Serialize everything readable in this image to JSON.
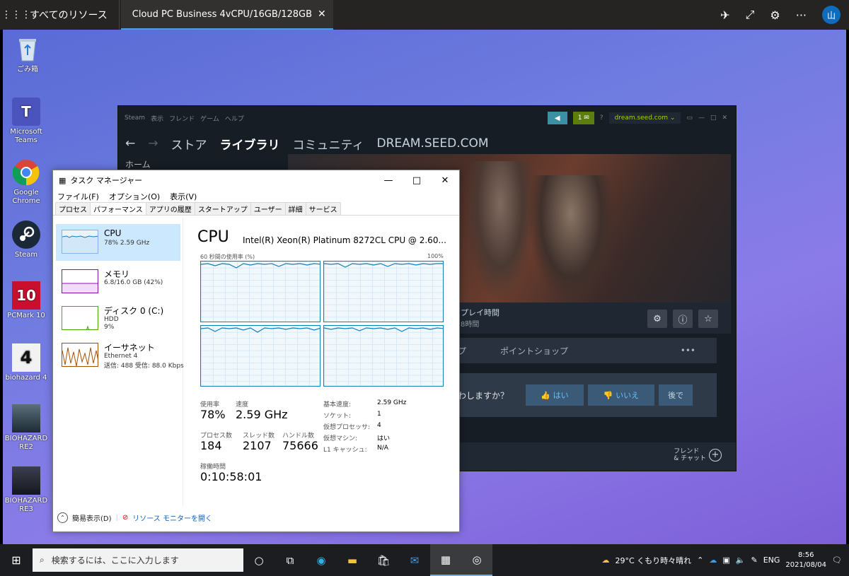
{
  "topbar": {
    "all_resources": "すべてのリソース",
    "tab_title": "Cloud PC Business 4vCPU/16GB/128GB",
    "avatar": "山"
  },
  "desktop_icons": [
    {
      "label": "ごみ箱"
    },
    {
      "label": "Microsoft Teams"
    },
    {
      "label": "Google Chrome"
    },
    {
      "label": "Steam"
    },
    {
      "label": "PCMark 10"
    },
    {
      "label": "biohazard 4"
    },
    {
      "label": "BIOHAZARD RE2"
    },
    {
      "label": "BIOHAZARD RE3"
    }
  ],
  "steam": {
    "menu": [
      "Steam",
      "表示",
      "フレンド",
      "ゲーム",
      "ヘルプ"
    ],
    "msg_count": "1",
    "account": "dream.seed.com ⌄",
    "nav": [
      "ストア",
      "ライブラリ",
      "コミュニティ",
      "DREAM.SEED.COM"
    ],
    "side_home": "ホーム",
    "playtime_label": "プレイ時間",
    "playtime_value": "8時間",
    "tab_left": "プ",
    "tab_points": "ポイントショップ",
    "tab_more": "•••",
    "prompt_text": "わしますか？",
    "btn_yes": "はい",
    "btn_no": "いいえ",
    "btn_later": "後で",
    "friends_line1": "フレンド",
    "friends_line2": "& チャット"
  },
  "taskmanager": {
    "title": "タスク マネージャー",
    "menu": [
      "ファイル(F)",
      "オプション(O)",
      "表示(V)"
    ],
    "tabs": [
      "プロセス",
      "パフォーマンス",
      "アプリの履歴",
      "スタートアップ",
      "ユーザー",
      "詳細",
      "サービス"
    ],
    "sidebar": [
      {
        "name": "CPU",
        "s1": "78%  2.59 GHz",
        "s2": ""
      },
      {
        "name": "メモリ",
        "s1": "6.8/16.0 GB (42%)",
        "s2": ""
      },
      {
        "name": "ディスク 0 (C:)",
        "s1": "HDD",
        "s2": "9%"
      },
      {
        "name": "イーサネット",
        "s1": "Ethernet 4",
        "s2": "送信: 488  受信: 88.0 Kbps"
      }
    ],
    "heading": "CPU",
    "cpu_name": "Intel(R) Xeon(R) Platinum 8272CL CPU @ 2.60...",
    "graph_label": "60 秒間の使用率 (%)",
    "graph_max": "100%",
    "stats": {
      "usage_label": "使用率",
      "usage": "78%",
      "speed_label": "速度",
      "speed": "2.59 GHz",
      "proc_label": "プロセス数",
      "proc": "184",
      "thread_label": "スレッド数",
      "thread": "2107",
      "handle_label": "ハンドル数",
      "handle": "75666",
      "uptime_label": "稼働時間",
      "uptime": "0:10:58:01"
    },
    "details": [
      {
        "k": "基本速度:",
        "v": "2.59 GHz"
      },
      {
        "k": "ソケット:",
        "v": "1"
      },
      {
        "k": "仮想プロセッサ:",
        "v": "4"
      },
      {
        "k": "仮想マシン:",
        "v": "はい"
      },
      {
        "k": "L1 キャッシュ:",
        "v": "N/A"
      }
    ],
    "fewer_details": "簡易表示(D)",
    "resource_monitor": "リソース モニターを開く"
  },
  "taskbar": {
    "search_placeholder": "検索するには、ここに入力します",
    "weather": "29°C  くもり時々晴れ",
    "lang": "ENG",
    "time": "8:56",
    "date": "2021/08/04"
  }
}
